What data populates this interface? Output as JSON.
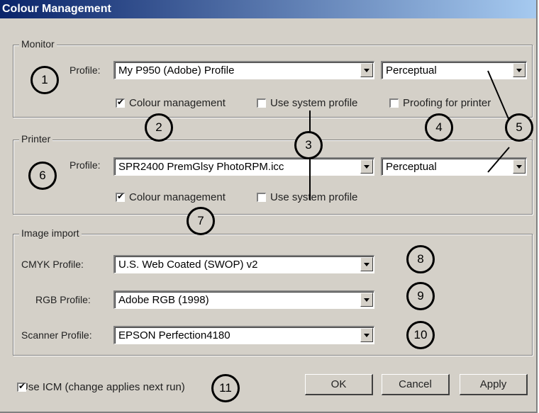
{
  "window": {
    "title": "Colour Management"
  },
  "monitor": {
    "legend": "Monitor",
    "profile_label": "Profile:",
    "profile_value": "My P950 (Adobe) Profile",
    "intent_value": "Perceptual",
    "colour_management": {
      "label": "Colour management",
      "checked": true
    },
    "use_system_profile": {
      "label": "Use system profile",
      "checked": false
    },
    "proofing_for_printer": {
      "label": "Proofing for printer",
      "checked": false
    }
  },
  "printer": {
    "legend": "Printer",
    "profile_label": "Profile:",
    "profile_value": "SPR2400 PremGlsy PhotoRPM.icc",
    "intent_value": "Perceptual",
    "colour_management": {
      "label": "Colour management",
      "checked": true
    },
    "use_system_profile": {
      "label": "Use system profile",
      "checked": false
    }
  },
  "image_import": {
    "legend": "Image import",
    "cmyk_label": "CMYK Profile:",
    "cmyk_value": "U.S. Web Coated (SWOP) v2",
    "rgb_label": "RGB Profile:",
    "rgb_value": "Adobe RGB (1998)",
    "scanner_label": "Scanner Profile:",
    "scanner_value": "EPSON Perfection4180"
  },
  "use_icm": {
    "label": "Use ICM (change applies next run)",
    "checked": true
  },
  "buttons": {
    "ok": "OK",
    "cancel": "Cancel",
    "apply": "Apply"
  },
  "callouts": [
    "1",
    "2",
    "3",
    "4",
    "5",
    "6",
    "7",
    "8",
    "9",
    "10",
    "11"
  ]
}
